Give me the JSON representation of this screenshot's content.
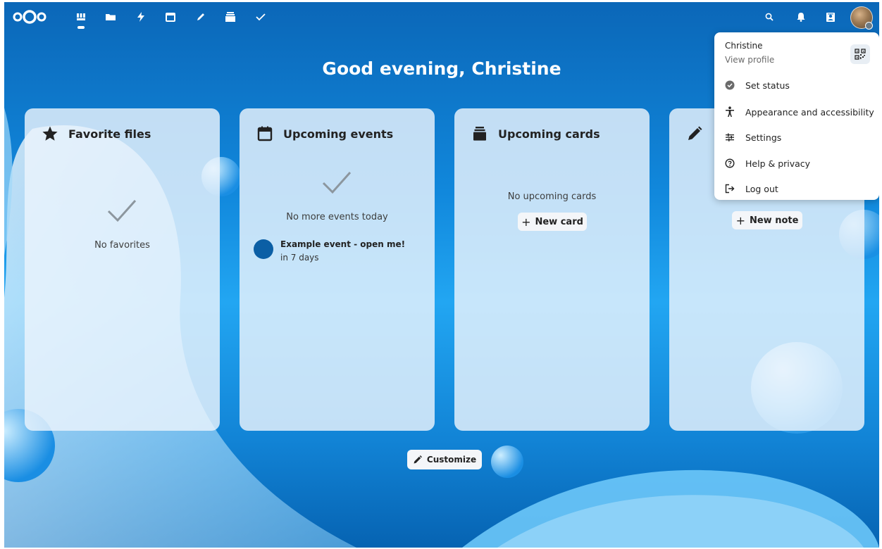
{
  "greeting": "Good evening, Christine",
  "widgets": {
    "favorites": {
      "title": "Favorite files",
      "empty": "No favorites"
    },
    "events": {
      "title": "Upcoming events",
      "empty": "No more events today",
      "items": [
        {
          "title": "Example event - open me!",
          "when": "in 7 days"
        }
      ]
    },
    "cards": {
      "title": "Upcoming cards",
      "empty": "No upcoming cards",
      "button": "New card"
    },
    "notes": {
      "button": "New note"
    }
  },
  "customize_label": "Customize",
  "user_menu": {
    "name": "Christine",
    "view_profile": "View profile",
    "items": [
      {
        "label": "Set status",
        "icon": "status-check-icon"
      },
      {
        "label": "Appearance and accessibility",
        "icon": "accessibility-icon"
      },
      {
        "label": "Settings",
        "icon": "sliders-icon"
      },
      {
        "label": "Help & privacy",
        "icon": "help-icon"
      },
      {
        "label": "Log out",
        "icon": "logout-icon"
      }
    ]
  },
  "header": {
    "apps": [
      "dashboard-icon",
      "files-icon",
      "activity-icon",
      "calendar-icon",
      "notes-icon",
      "deck-icon",
      "tasks-icon"
    ],
    "right": [
      "search-icon",
      "notifications-icon",
      "contacts-icon",
      "avatar"
    ]
  },
  "colors": {
    "brand": "#0082c9",
    "event_dot": "#0b5fa5"
  }
}
